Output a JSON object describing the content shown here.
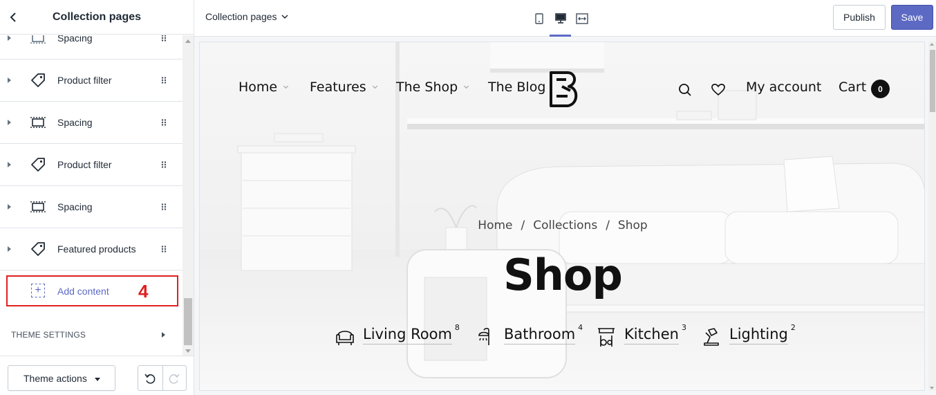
{
  "sidebar": {
    "title": "Collection pages",
    "items": [
      {
        "label": "Spacing",
        "icon": "spacing-icon"
      },
      {
        "label": "Product filter",
        "icon": "tag-icon"
      },
      {
        "label": "Spacing",
        "icon": "spacing-icon"
      },
      {
        "label": "Product filter",
        "icon": "tag-icon"
      },
      {
        "label": "Spacing",
        "icon": "spacing-icon"
      },
      {
        "label": "Featured products",
        "icon": "tag-icon"
      }
    ],
    "add_content": {
      "label": "Add content",
      "annotation": "4"
    },
    "theme_settings": "THEME SETTINGS",
    "footer": {
      "theme_actions": "Theme actions"
    }
  },
  "topbar": {
    "page_select": "Collection pages",
    "devices": [
      "mobile-icon",
      "desktop-icon",
      "fullwidth-icon"
    ],
    "active_device": "desktop-icon",
    "publish": "Publish",
    "save": "Save"
  },
  "preview": {
    "nav_left": [
      {
        "label": "Home"
      },
      {
        "label": "Features"
      },
      {
        "label": "The Shop"
      },
      {
        "label": "The Blog"
      }
    ],
    "nav_right": {
      "account": "My account",
      "cart": "Cart",
      "cart_count": "0"
    },
    "breadcrumb": [
      "Home",
      "/",
      "Collections",
      "/",
      "Shop"
    ],
    "title": "Shop",
    "categories": [
      {
        "name": "Living Room",
        "count": "8",
        "icon": "armchair-icon"
      },
      {
        "name": "Bathroom",
        "count": "4",
        "icon": "shower-icon"
      },
      {
        "name": "Kitchen",
        "count": "3",
        "icon": "kitchen-icon"
      },
      {
        "name": "Lighting",
        "count": "2",
        "icon": "desk-lamp-icon"
      }
    ]
  },
  "colors": {
    "accent": "#5c6ac4",
    "annotation": "#e02020",
    "text": "#212b36"
  }
}
